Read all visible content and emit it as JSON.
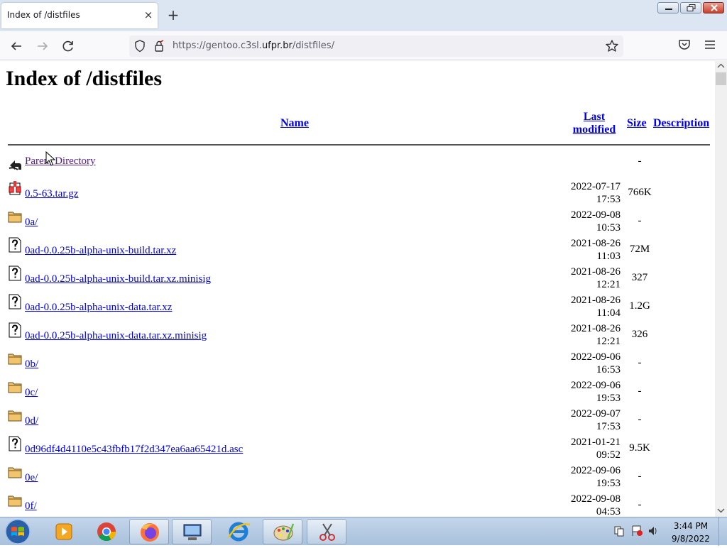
{
  "browser": {
    "tab_title": "Index of /distfiles",
    "tab_close": "×",
    "new_tab": "+",
    "url_prefix": "https://gentoo.c3sl.",
    "url_host": "ufpr.br",
    "url_path": "/distfiles/"
  },
  "page": {
    "heading": "Index of /distfiles",
    "columns": {
      "name": "Name",
      "modified_line1": "Last",
      "modified_line2": "modified",
      "size": "Size",
      "description": "Description"
    },
    "rows": [
      {
        "icon": "parent-directory-icon",
        "name": "Parent Directory",
        "date": "",
        "time": "",
        "size": "-"
      },
      {
        "icon": "archive-icon",
        "name": "0.5-63.tar.gz",
        "date": "2022-07-17",
        "time": "17:53",
        "size": "766K"
      },
      {
        "icon": "folder-icon",
        "name": "0a/",
        "date": "2022-09-08",
        "time": "10:53",
        "size": "-"
      },
      {
        "icon": "unknown-file-icon",
        "name": "0ad-0.0.25b-alpha-unix-build.tar.xz",
        "date": "2021-08-26",
        "time": "11:03",
        "size": "72M"
      },
      {
        "icon": "unknown-file-icon",
        "name": "0ad-0.0.25b-alpha-unix-build.tar.xz.minisig",
        "date": "2021-08-26",
        "time": "12:21",
        "size": "327"
      },
      {
        "icon": "unknown-file-icon",
        "name": "0ad-0.0.25b-alpha-unix-data.tar.xz",
        "date": "2021-08-26",
        "time": "11:04",
        "size": "1.2G"
      },
      {
        "icon": "unknown-file-icon",
        "name": "0ad-0.0.25b-alpha-unix-data.tar.xz.minisig",
        "date": "2021-08-26",
        "time": "12:21",
        "size": "326"
      },
      {
        "icon": "folder-icon",
        "name": "0b/",
        "date": "2022-09-06",
        "time": "16:53",
        "size": "-"
      },
      {
        "icon": "folder-icon",
        "name": "0c/",
        "date": "2022-09-06",
        "time": "19:53",
        "size": "-"
      },
      {
        "icon": "folder-icon",
        "name": "0d/",
        "date": "2022-09-07",
        "time": "17:53",
        "size": "-"
      },
      {
        "icon": "unknown-file-icon",
        "name": "0d96df4d4110e5c43fbfb17f2d347ea6aa65421d.asc",
        "date": "2021-01-21",
        "time": "09:52",
        "size": "9.5K"
      },
      {
        "icon": "folder-icon",
        "name": "0e/",
        "date": "2022-09-06",
        "time": "19:53",
        "size": "-"
      },
      {
        "icon": "folder-icon",
        "name": "0f/",
        "date": "2022-09-08",
        "time": "04:53",
        "size": "-"
      }
    ]
  },
  "taskbar": {
    "time": "3:44 PM",
    "date": "9/8/2022"
  },
  "colors": {
    "link": "#0000ee",
    "visited_link": "#551a8b",
    "taskbar": "#b5cbe3"
  }
}
